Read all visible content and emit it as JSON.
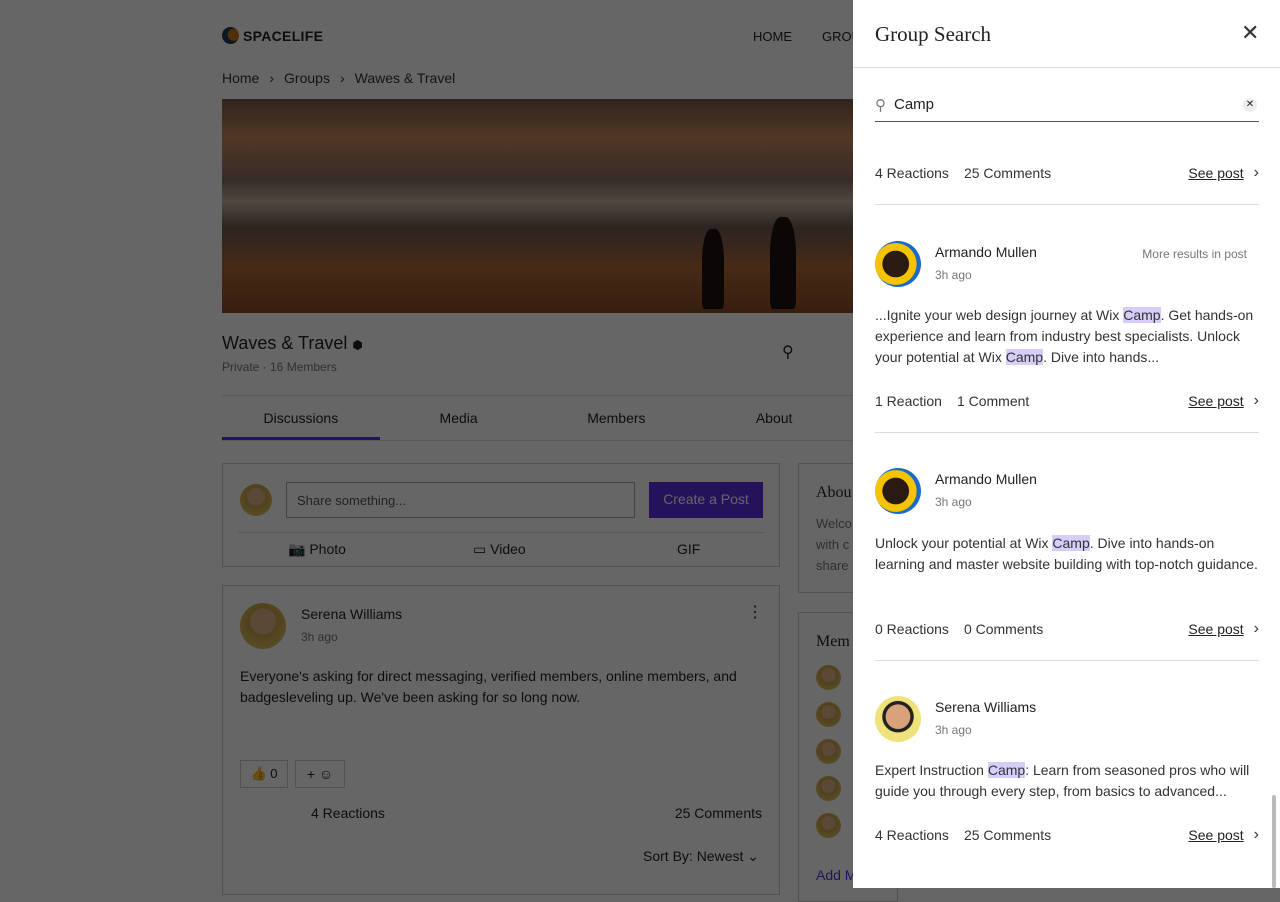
{
  "site": {
    "logo": "SPACELIFE",
    "nav": [
      "HOME",
      "GROU"
    ]
  },
  "breadcrumb": [
    "Home",
    "Groups",
    "Wawes & Travel"
  ],
  "group": {
    "title": "Waves & Travel",
    "subtitle": "Private · 16 Members"
  },
  "tabs": [
    "Discussions",
    "Media",
    "Members",
    "About"
  ],
  "composer": {
    "placeholder": "Share something...",
    "create": "Create a Post",
    "photo": "Photo",
    "video": "Video",
    "gif": "GIF"
  },
  "post": {
    "author": "Serena Williams",
    "time": "3h ago",
    "text": "Everyone's asking for direct messaging, verified members, online members, and badgesleveling up. We've been asking for so long now.",
    "likes": "0",
    "reactions": "4 Reactions",
    "comments": "25 Comments",
    "sort_label": "Sort By:",
    "sort_value": "Newest"
  },
  "about": {
    "title": "Abou",
    "lines": [
      "Welco",
      "with c",
      "share"
    ]
  },
  "members": {
    "title": "Mem",
    "add": "Add M"
  },
  "panel": {
    "title": "Group Search",
    "search_value": "Camp",
    "top_stats": {
      "reactions": "4 Reactions",
      "comments": "25 Comments",
      "see": "See post"
    },
    "results": [
      {
        "author": "Armando Mullen",
        "time": "3h ago",
        "more": "More results in post",
        "parts": [
          "...Ignite your web design journey at Wix ",
          "Camp",
          ". Get hands-on experience and learn from industry best specialists. Unlock your potential at Wix ",
          "Camp",
          ". Dive into hands..."
        ],
        "reactions": "1 Reaction",
        "comments": "1 Comment",
        "see": "See post"
      },
      {
        "author": "Armando Mullen",
        "time": "3h ago",
        "parts": [
          "Unlock your potential at Wix ",
          "Camp",
          ". Dive into hands-on learning and master website building with top-notch guidance."
        ],
        "reactions": "0 Reactions",
        "comments": "0 Comments",
        "see": "See post"
      },
      {
        "author": "Serena Williams",
        "time": "3h ago",
        "parts": [
          "Expert Instruction ",
          "Camp",
          ": Learn from seasoned pros who will guide you through every step, from basics to advanced..."
        ],
        "reactions": "4 Reactions",
        "comments": "25 Comments",
        "see": "See post"
      }
    ]
  },
  "colors": {
    "accent": "#5b2ee0",
    "highlight": "#d8ccfb"
  }
}
